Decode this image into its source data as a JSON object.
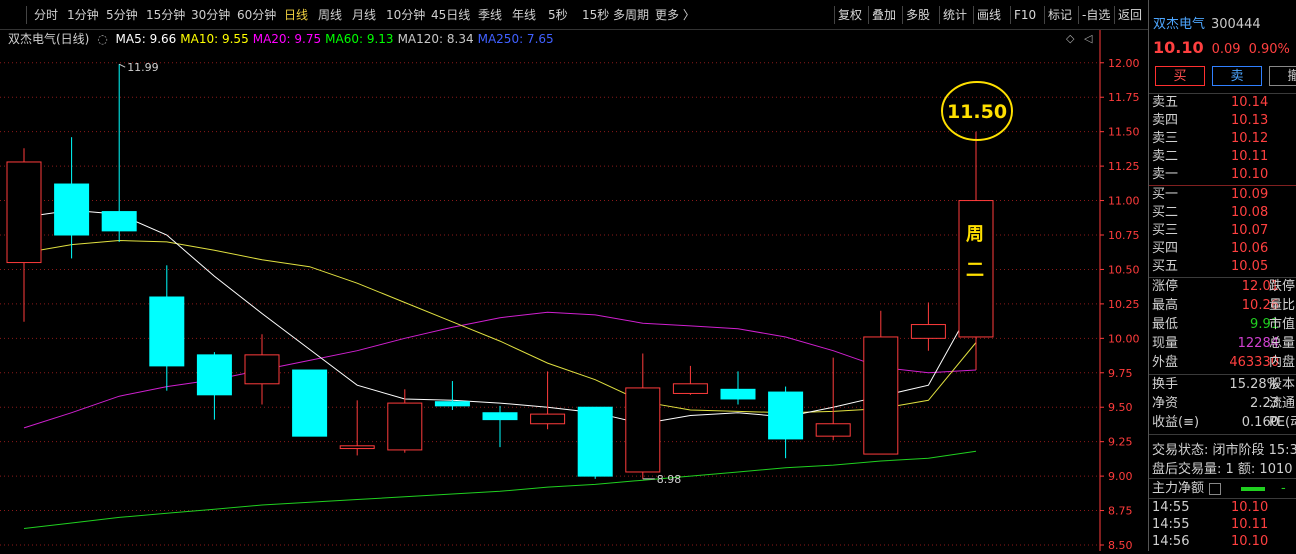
{
  "toolbar": {
    "periods": [
      "分时",
      "1分钟",
      "5分钟",
      "15分钟",
      "30分钟",
      "60分钟",
      "日线",
      "周线",
      "月线",
      "10分钟",
      "45日线",
      "季线",
      "年线",
      "5秒",
      "15秒",
      "多周期",
      "更多 〉"
    ],
    "active_period": "日线",
    "right_items": [
      "复权",
      "叠加",
      "多股",
      "统计",
      "画线",
      "F10",
      "标记",
      "-自选",
      "返回"
    ]
  },
  "legend": {
    "name": "双杰电气(日线)",
    "items": [
      {
        "label": "MA5: 9.66",
        "color": "#ffffff"
      },
      {
        "label": "MA10: 9.55",
        "color": "#ffff00"
      },
      {
        "label": "MA20: 9.75",
        "color": "#ff00ff"
      },
      {
        "label": "MA60: 9.13",
        "color": "#00ff00"
      },
      {
        "label": "MA120: 8.34",
        "color": "#c8c8c8"
      },
      {
        "label": "MA250: 7.65",
        "color": "#4060ff"
      }
    ]
  },
  "chart_data": {
    "type": "candlestick",
    "ylim": [
      8.5,
      12.1
    ],
    "y_ticks": [
      "12.00",
      "11.75",
      "11.50",
      "11.25",
      "11.00",
      "10.75",
      "10.50",
      "10.25",
      "10.00",
      "9.75",
      "9.50",
      "9.25",
      "9.00",
      "8.75",
      "8.50"
    ],
    "candles": [
      {
        "open": 10.55,
        "high": 11.38,
        "low": 10.12,
        "close": 11.28
      },
      {
        "open": 11.12,
        "high": 11.46,
        "low": 10.58,
        "close": 10.75
      },
      {
        "open": 10.92,
        "high": 11.99,
        "low": 10.7,
        "close": 10.78
      },
      {
        "open": 10.3,
        "high": 10.53,
        "low": 9.62,
        "close": 9.8
      },
      {
        "open": 9.88,
        "high": 9.9,
        "low": 9.41,
        "close": 9.59
      },
      {
        "open": 9.67,
        "high": 10.03,
        "low": 9.52,
        "close": 9.88
      },
      {
        "open": 9.77,
        "high": 9.77,
        "low": 9.29,
        "close": 9.29
      },
      {
        "open": 9.2,
        "high": 9.55,
        "low": 9.15,
        "close": 9.22
      },
      {
        "open": 9.19,
        "high": 9.63,
        "low": 9.17,
        "close": 9.53
      },
      {
        "open": 9.54,
        "high": 9.69,
        "low": 9.48,
        "close": 9.51
      },
      {
        "open": 9.46,
        "high": 9.51,
        "low": 9.21,
        "close": 9.41
      },
      {
        "open": 9.38,
        "high": 9.76,
        "low": 9.34,
        "close": 9.45
      },
      {
        "open": 9.5,
        "high": 9.5,
        "low": 8.98,
        "close": 9.0
      },
      {
        "open": 9.03,
        "high": 9.89,
        "low": 8.98,
        "close": 9.64
      },
      {
        "open": 9.6,
        "high": 9.8,
        "low": 9.59,
        "close": 9.67
      },
      {
        "open": 9.63,
        "high": 9.76,
        "low": 9.52,
        "close": 9.56
      },
      {
        "open": 9.61,
        "high": 9.65,
        "low": 9.13,
        "close": 9.27
      },
      {
        "open": 9.29,
        "high": 9.86,
        "low": 9.26,
        "close": 9.38
      },
      {
        "open": 9.16,
        "high": 10.2,
        "low": 9.16,
        "close": 10.01
      },
      {
        "open": 10.0,
        "high": 10.26,
        "low": 9.91,
        "close": 10.1
      },
      {
        "open": 10.01,
        "high": 11.5,
        "low": 9.77,
        "close": 11.0
      }
    ],
    "ma5": [
      10.88,
      10.93,
      10.9,
      10.75,
      10.45,
      10.18,
      9.92,
      9.66,
      9.56,
      9.55,
      9.53,
      9.5,
      9.46,
      9.38,
      9.44,
      9.46,
      9.43,
      9.5,
      9.58,
      9.66,
      10.28
    ],
    "ma10": [
      10.62,
      10.68,
      10.71,
      10.7,
      10.64,
      10.57,
      10.52,
      10.4,
      10.26,
      10.12,
      9.98,
      9.82,
      9.7,
      9.54,
      9.48,
      9.47,
      9.46,
      9.47,
      9.49,
      9.55,
      9.97
    ],
    "ma20": [
      9.35,
      9.46,
      9.58,
      9.65,
      9.7,
      9.77,
      9.84,
      9.91,
      10.0,
      10.08,
      10.15,
      10.19,
      10.17,
      10.11,
      10.09,
      10.07,
      10.01,
      9.91,
      9.79,
      9.75,
      9.77
    ],
    "ma60": [
      8.62,
      8.66,
      8.7,
      8.73,
      8.76,
      8.79,
      8.81,
      8.83,
      8.85,
      8.87,
      8.89,
      8.92,
      8.94,
      8.97,
      9.0,
      9.03,
      9.06,
      9.08,
      9.11,
      9.13,
      9.18
    ],
    "annotations": {
      "high_label": "11.99",
      "low_label": "8.98",
      "circle_label": "11.50",
      "weekday_label": [
        "周",
        "二"
      ]
    }
  },
  "quote": {
    "name": "双杰电气",
    "code": "300444",
    "price": "10.10",
    "change": "0.09",
    "pct": "0.90%",
    "buttons": [
      "买",
      "卖",
      "撤"
    ]
  },
  "book": {
    "sell": [
      {
        "label": "卖五",
        "price": "10.14"
      },
      {
        "label": "卖四",
        "price": "10.13"
      },
      {
        "label": "卖三",
        "price": "10.12"
      },
      {
        "label": "卖二",
        "price": "10.11"
      },
      {
        "label": "卖一",
        "price": "10.10"
      }
    ],
    "buy": [
      {
        "label": "买一",
        "price": "10.09"
      },
      {
        "label": "买二",
        "price": "10.08"
      },
      {
        "label": "买三",
        "price": "10.07"
      },
      {
        "label": "买四",
        "price": "10.06"
      },
      {
        "label": "买五",
        "price": "10.05"
      }
    ]
  },
  "stats": [
    {
      "label": "涨停",
      "value": "12.01",
      "label2": "跌停",
      "color": "#ff4040"
    },
    {
      "label": "最高",
      "value": "10.26",
      "label2": "量比",
      "color": "#ff4040"
    },
    {
      "label": "最低",
      "value": "9.91",
      "label2": "市值",
      "color": "#20d020"
    },
    {
      "label": "现量",
      "value": "12284",
      "label2": "总量",
      "color": "#d040d0"
    },
    {
      "label": "外盘",
      "value": "463330",
      "label2": "内盘",
      "color": "#ff4040"
    }
  ],
  "stats2": [
    {
      "label": "换手",
      "value": "15.28%",
      "label2": "股本"
    },
    {
      "label": "净资",
      "value": "2.23",
      "label2": "流通"
    },
    {
      "label": "收益(≡)",
      "value": "0.160",
      "label2": "PE(动"
    }
  ],
  "status": {
    "state": "交易状态: 闭市阶段 15:3",
    "after": "盘后交易量: 1  额: 1010"
  },
  "flow": {
    "label": "主力净额"
  },
  "ticks": [
    {
      "time": "14:55",
      "price": "10.10"
    },
    {
      "time": "14:55",
      "price": "10.11"
    },
    {
      "time": "14:56",
      "price": "10.10"
    }
  ],
  "colors": {
    "up": "#ff3c3c",
    "down": "#00ffff",
    "grid": "#8b1a1a",
    "axis": "#ff3c3c"
  }
}
